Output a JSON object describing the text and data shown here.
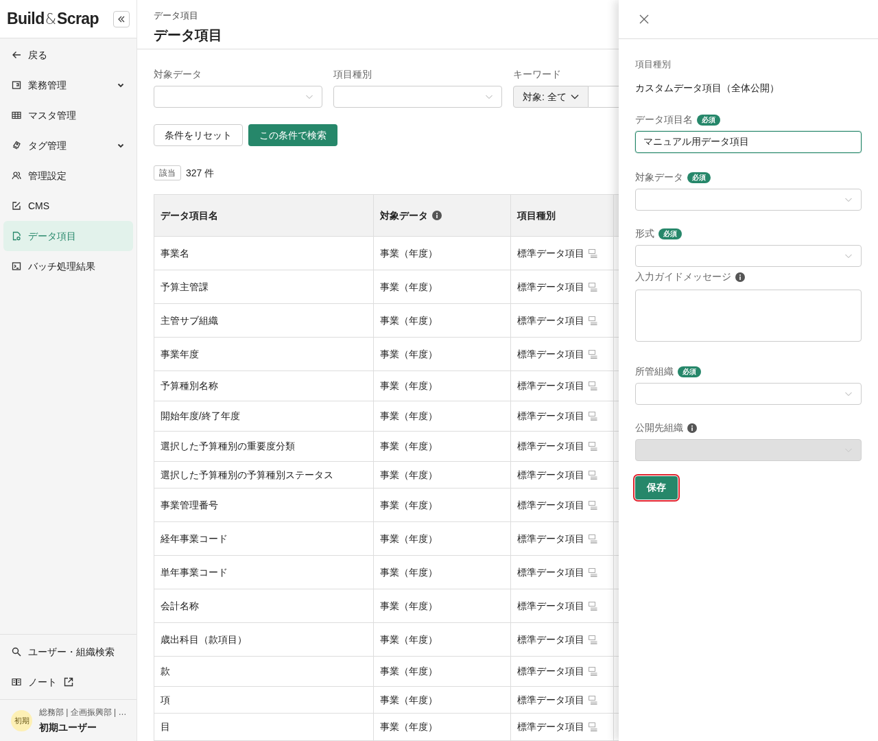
{
  "sidebar": {
    "logo_main": "Build",
    "logo_amp": "&",
    "logo_end": "Scrap",
    "back": "戻る",
    "items": [
      {
        "label": "業務管理",
        "has_submenu": true,
        "selected": false
      },
      {
        "label": "マスタ管理",
        "has_submenu": false,
        "selected": false
      },
      {
        "label": "タグ管理",
        "has_submenu": true,
        "selected": false
      },
      {
        "label": "管理設定",
        "has_submenu": false,
        "selected": false
      },
      {
        "label": "CMS",
        "has_submenu": false,
        "selected": false
      },
      {
        "label": "データ項目",
        "has_submenu": false,
        "selected": true
      },
      {
        "label": "バッチ処理結果",
        "has_submenu": false,
        "selected": false
      }
    ],
    "footer_links": [
      {
        "label": "ユーザー・組織検索",
        "external": false
      },
      {
        "label": "ノート",
        "external": true
      }
    ],
    "user": {
      "avatar": "初期",
      "orgs": "総務部 | 企画振興部 | …",
      "name": "初期ユーザー"
    }
  },
  "main": {
    "breadcrumb": "データ項目",
    "title": "データ項目",
    "filters": [
      {
        "label": "対象データ"
      },
      {
        "label": "項目種別"
      }
    ],
    "keyword": {
      "label": "キーワード",
      "scope": "対象: 全て"
    },
    "buttons": [
      {
        "label": "条件をリセット",
        "primary": false
      },
      {
        "label": "この条件で検索",
        "primary": true
      }
    ],
    "count": {
      "badge": "該当",
      "text": "327 件"
    },
    "table": {
      "columns": [
        {
          "label": "データ項目名",
          "info": false
        },
        {
          "label": "対象データ",
          "info": true
        },
        {
          "label": "項目種別",
          "info": false
        }
      ],
      "rows": [
        [
          "事業名",
          "事業（年度）",
          "標準データ項目"
        ],
        [
          "予算主管課",
          "事業（年度）",
          "標準データ項目"
        ],
        [
          "主管サブ組織",
          "事業（年度）",
          "標準データ項目"
        ],
        [
          "事業年度",
          "事業（年度）",
          "標準データ項目"
        ],
        [
          "予算種別名称",
          "事業（年度）",
          "標準データ項目"
        ],
        [
          "開始年度/終了年度",
          "事業（年度）",
          "標準データ項目"
        ],
        [
          "選択した予算種別の重要度分類",
          "事業（年度）",
          "標準データ項目"
        ],
        [
          "選択した予算種別の予算種別ステータス",
          "事業（年度）",
          "標準データ項目"
        ],
        [
          "事業管理番号",
          "事業（年度）",
          "標準データ項目"
        ],
        [
          "経年事業コード",
          "事業（年度）",
          "標準データ項目"
        ],
        [
          "単年事業コード",
          "事業（年度）",
          "標準データ項目"
        ],
        [
          "会計名称",
          "事業（年度）",
          "標準データ項目"
        ],
        [
          "歳出科目（款項目）",
          "事業（年度）",
          "標準データ項目"
        ],
        [
          "款",
          "事業（年度）",
          "標準データ項目"
        ],
        [
          "項",
          "事業（年度）",
          "標準データ項目"
        ],
        [
          "目",
          "事業（年度）",
          "標準データ項目"
        ]
      ]
    }
  },
  "panel": {
    "type_label": "項目種別",
    "type_value": "カスタムデータ項目（全体公開）",
    "fields": [
      {
        "kind": "input",
        "label": "データ項目名",
        "badge": "必須",
        "info": false,
        "value": "マニュアル用データ項目",
        "disabled": false
      },
      {
        "kind": "select",
        "label": "対象データ",
        "badge": "必須",
        "info": false,
        "disabled": false
      },
      {
        "kind": "select",
        "label": "形式",
        "badge": "必須",
        "info": false,
        "disabled": false
      },
      {
        "kind": "textarea",
        "label": "入力ガイドメッセージ",
        "info": true,
        "disabled": false
      },
      {
        "kind": "select",
        "label": "所管組織",
        "badge": "必須",
        "info": false,
        "disabled": false
      },
      {
        "kind": "select",
        "label": "公開先組織",
        "info": true,
        "disabled": true
      }
    ],
    "save": {
      "label": "保存",
      "highlighted": true
    }
  }
}
